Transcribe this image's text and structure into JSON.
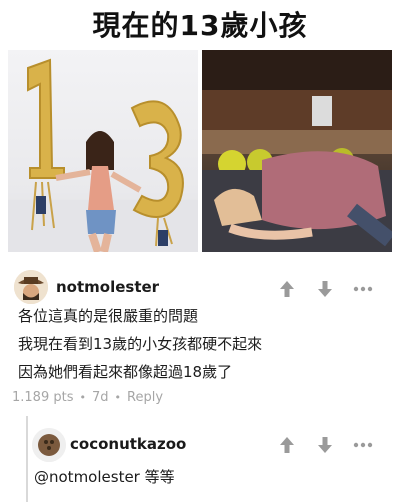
{
  "meme": {
    "title": "現在的13歲小孩"
  },
  "photos": {
    "left_balloon_digits": [
      "1",
      "3"
    ]
  },
  "comment": {
    "username": "notmolester",
    "lines": [
      "各位這真的是很嚴重的問題",
      "我現在看到13歲的小女孩都硬不起來",
      "因為她們看起來都像超過18歲了"
    ],
    "points": "1.189 pts",
    "age": "7d",
    "reply_label": "Reply",
    "separator": "•"
  },
  "reply": {
    "username": "coconutkazoo",
    "text": "@notmolester  等等"
  },
  "icons": {
    "upvote": "arrow-up-icon",
    "downvote": "arrow-down-icon",
    "more": "more-dots-icon",
    "color": "#9a9a9a"
  }
}
